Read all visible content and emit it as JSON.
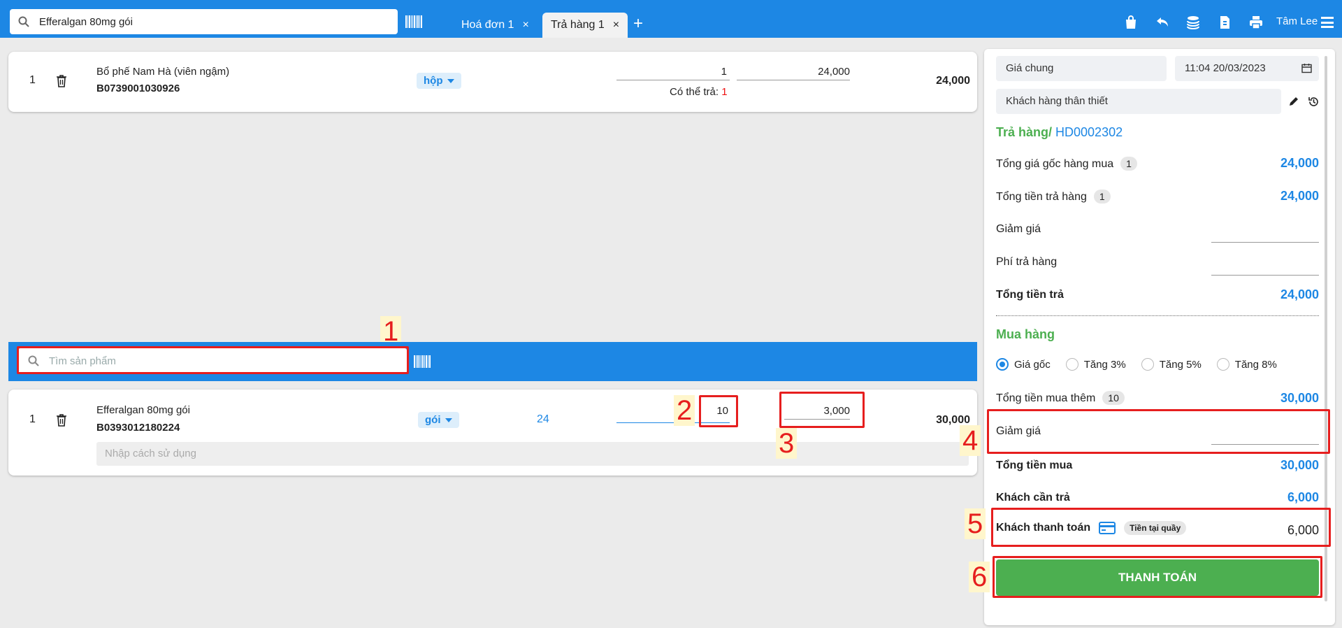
{
  "header": {
    "search_value": "Efferalgan 80mg gói",
    "tabs": [
      {
        "label": "Hoá đơn 1",
        "close": "×"
      },
      {
        "label": "Trả hàng 1",
        "close": "×"
      }
    ],
    "add_tab": "+",
    "user_name": "Tâm Lee",
    "icons": [
      "bag-icon",
      "undo-icon",
      "coins-icon",
      "document-icon",
      "print-icon",
      "menu-icon"
    ]
  },
  "return_items": [
    {
      "index": "1",
      "name": "Bổ phế Nam Hà (viên ngậm)",
      "code": "B0739001030926",
      "unit": "hộp",
      "quantity": "1",
      "price": "24,000",
      "available_label": "Có thể trả:",
      "available_value": "1",
      "total": "24,000"
    }
  ],
  "purchase_search": {
    "placeholder": "Tìm sản phẩm"
  },
  "purchase_items": [
    {
      "index": "1",
      "name": "Efferalgan 80mg gói",
      "code": "B0393012180224",
      "unit": "gói",
      "stock": "24",
      "quantity": "10",
      "price": "3,000",
      "total": "30,000",
      "usage_placeholder": "Nhập cách sử dụng"
    }
  ],
  "annotations": [
    "1",
    "2",
    "3",
    "4",
    "5",
    "6"
  ],
  "panel": {
    "price_list": "Giá chung",
    "datetime": "11:04 20/03/2023",
    "customer": "Khách hàng thân thiết",
    "return_title": "Trả hàng/",
    "return_invoice": "HD0002302",
    "original_total_label": "Tổng giá gốc hàng mua",
    "original_total_count": "1",
    "original_total_value": "24,000",
    "return_total_label": "Tổng tiền trả hàng",
    "return_total_count": "1",
    "return_total_value": "24,000",
    "discount_label": "Giảm giá",
    "return_fee_label": "Phí trả hàng",
    "refund_total_label": "Tổng tiền trả",
    "refund_total_value": "24,000",
    "purchase_title": "Mua hàng",
    "price_options": [
      "Giá gốc",
      "Tăng 3%",
      "Tăng 5%",
      "Tăng 8%"
    ],
    "selected_option": "Giá gốc",
    "extra_total_label": "Tổng tiền mua thêm",
    "extra_total_count": "10",
    "extra_total_value": "30,000",
    "purchase_discount_label": "Giảm giá",
    "purchase_total_label": "Tổng tiền mua",
    "purchase_total_value": "30,000",
    "customer_pays_label": "Khách cần trả",
    "customer_pays_value": "6,000",
    "customer_paid_label": "Khách thanh toán",
    "payment_method": "Tiền tại quầy",
    "customer_paid_value": "6,000",
    "pay_button": "THANH TOÁN"
  },
  "colors": {
    "primary": "#1d87e4",
    "success": "#4caf50",
    "annotation": "#e61e1e"
  }
}
